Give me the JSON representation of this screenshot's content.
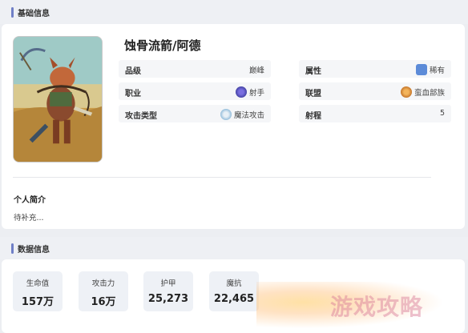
{
  "basic_info": {
    "section_title": "基础信息",
    "hero_name": "蚀骨流箭/阿德",
    "attributes": {
      "rank_label": "品级",
      "rank_value": "巅峰",
      "property_label": "属性",
      "property_value": "稀有",
      "class_label": "职业",
      "class_value": "射手",
      "alliance_label": "联盟",
      "alliance_value": "蛮血部族",
      "attack_type_label": "攻击类型",
      "attack_type_value": "魔法攻击",
      "range_label": "射程",
      "range_value": "5"
    },
    "intro_title": "个人简介",
    "intro_text": "待补充..."
  },
  "data_info": {
    "section_title": "数据信息",
    "stats": [
      {
        "label": "生命值",
        "value": "157万"
      },
      {
        "label": "攻击力",
        "value": "16万"
      },
      {
        "label": "护甲",
        "value": "25,273"
      },
      {
        "label": "魔抗",
        "value": "22,465"
      }
    ]
  },
  "colors": {
    "accent_bar": "#6f7fc6",
    "background": "#eceef2",
    "card": "#ffffff"
  },
  "icons": {
    "property": "rarity-icon",
    "class": "archer-class-icon",
    "attack_type": "magic-attack-icon",
    "alliance": "barbarian-tribe-icon"
  }
}
